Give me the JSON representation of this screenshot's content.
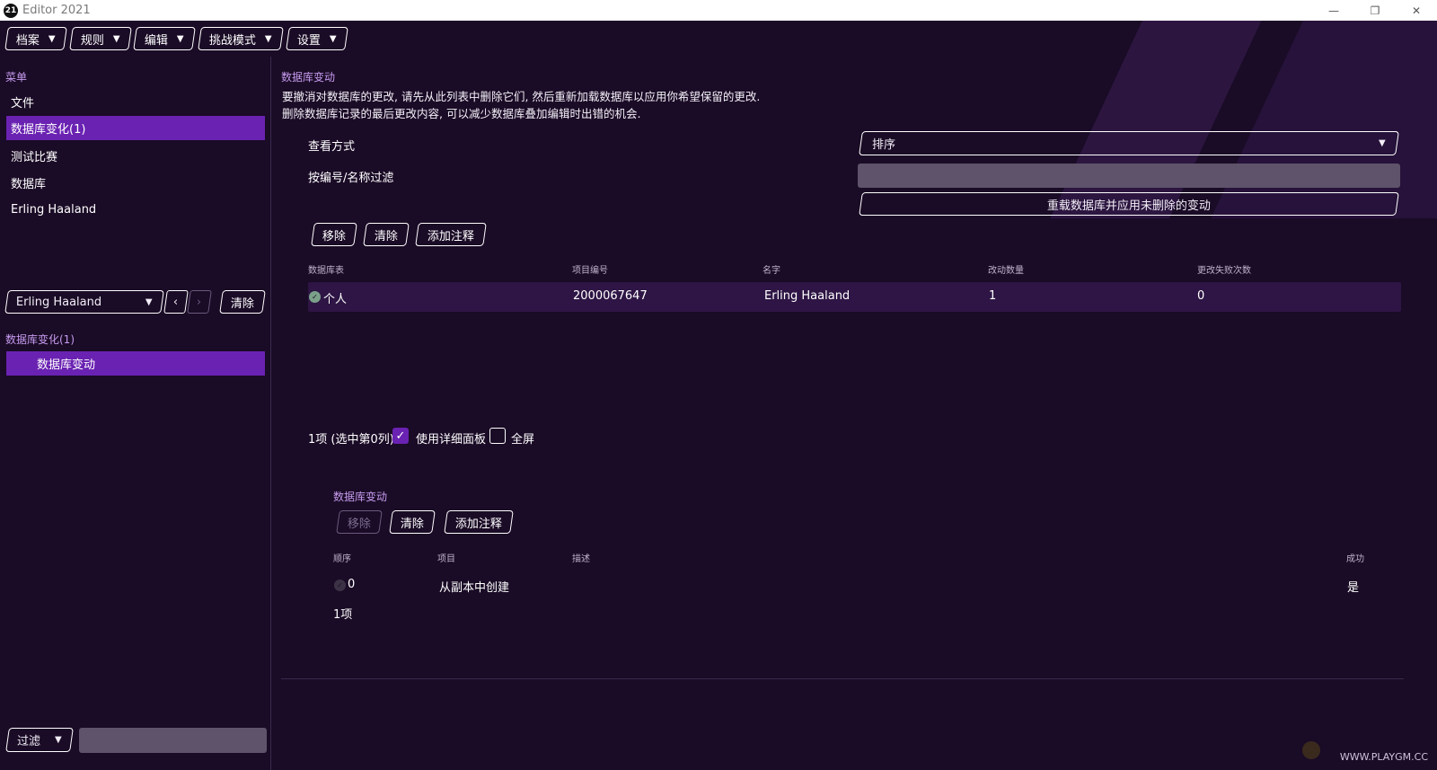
{
  "window": {
    "logo_text": "21",
    "title": "Editor 2021"
  },
  "window_controls": {
    "minimize": "—",
    "restore": "❐",
    "close": "✕"
  },
  "menubar": [
    {
      "label": "档案"
    },
    {
      "label": "规则"
    },
    {
      "label": "编辑"
    },
    {
      "label": "挑战模式"
    },
    {
      "label": "设置"
    }
  ],
  "sidebar": {
    "menu_heading": "菜单",
    "items": [
      "文件",
      "数据库变化(1)",
      "测试比赛",
      "数据库",
      "Erling Haaland"
    ],
    "active_index": 1,
    "player_combo": "Erling Haaland",
    "clear_label": "清除",
    "changes_heading": "数据库变化(1)",
    "changes_item": "数据库变动",
    "filter_label": "过滤"
  },
  "main": {
    "section_title": "数据库变动",
    "desc_line1": "要撤消对数据库的更改, 请先从此列表中删除它们, 然后重新加载数据库以应用你希望保留的更改.",
    "desc_line2": "删除数据库记录的最后更改内容, 可以减少数据库叠加编辑时出错的机会.",
    "view_label": "查看方式",
    "view_value": "排序",
    "filter_label": "按编号/名称过滤",
    "reload_label": "重载数据库并应用未删除的变动",
    "actions": {
      "remove": "移除",
      "clear": "清除",
      "add_note": "添加注释"
    },
    "table": {
      "headers": [
        "数据库表",
        "项目编号",
        "名字",
        "改动数量",
        "更改失败次数"
      ],
      "rows": [
        [
          "个人",
          "2000067647",
          "Erling Haaland",
          "1",
          "0"
        ]
      ]
    },
    "status_text": "1项 (选中第0列)",
    "detail_panel_label": "使用详细面板",
    "fullscreen_label": "全屏",
    "detail": {
      "title": "数据库变动",
      "actions": {
        "remove": "移除",
        "clear": "清除",
        "add_note": "添加注释"
      },
      "headers": [
        "顺序",
        "项目",
        "描述",
        "成功"
      ],
      "rows": [
        [
          "0",
          "从副本中创建",
          "",
          "是"
        ]
      ],
      "count": "1项"
    }
  },
  "watermark": "WWW.PLAYGM.CC"
}
